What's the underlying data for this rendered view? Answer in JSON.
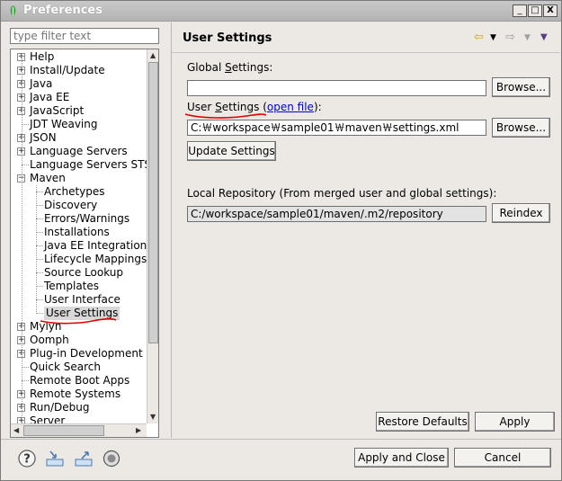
{
  "window": {
    "title": "Preferences",
    "controls": {
      "minimize": "_",
      "maximize": "□",
      "close": "X"
    }
  },
  "filter": {
    "placeholder": "type filter text"
  },
  "tree": {
    "items": [
      {
        "label": "Help",
        "expander": "+"
      },
      {
        "label": "Install/Update",
        "expander": "+"
      },
      {
        "label": "Java",
        "expander": "+"
      },
      {
        "label": "Java EE",
        "expander": "+"
      },
      {
        "label": "JavaScript",
        "expander": "+"
      },
      {
        "label": "JDT Weaving",
        "expander": ""
      },
      {
        "label": "JSON",
        "expander": "+"
      },
      {
        "label": "Language Servers",
        "expander": "+"
      },
      {
        "label": "Language Servers STS",
        "expander": ""
      },
      {
        "label": "Maven",
        "expander": "−"
      },
      {
        "label": "Archetypes",
        "expander": ""
      },
      {
        "label": "Discovery",
        "expander": ""
      },
      {
        "label": "Errors/Warnings",
        "expander": ""
      },
      {
        "label": "Installations",
        "expander": ""
      },
      {
        "label": "Java EE Integration",
        "expander": ""
      },
      {
        "label": "Lifecycle Mappings",
        "expander": ""
      },
      {
        "label": "Source Lookup",
        "expander": ""
      },
      {
        "label": "Templates",
        "expander": ""
      },
      {
        "label": "User Interface",
        "expander": ""
      },
      {
        "label": "User Settings",
        "expander": ""
      },
      {
        "label": "Mylyn",
        "expander": "+"
      },
      {
        "label": "Oomph",
        "expander": "+"
      },
      {
        "label": "Plug-in Development",
        "expander": "+"
      },
      {
        "label": "Quick Search",
        "expander": ""
      },
      {
        "label": "Remote Boot Apps",
        "expander": ""
      },
      {
        "label": "Remote Systems",
        "expander": "+"
      },
      {
        "label": "Run/Debug",
        "expander": "+"
      },
      {
        "label": "Server",
        "expander": "+"
      }
    ]
  },
  "page": {
    "title": "User Settings",
    "global_settings": {
      "label_pre": "Global ",
      "label_ul": "S",
      "label_post": "ettings:",
      "value": "",
      "browse": "Browse..."
    },
    "user_settings": {
      "label_pre": "User ",
      "label_ul": "S",
      "label_post": "ettings (",
      "link": "open file",
      "label_end": "):",
      "value": "C:￦workspace￦sample01￦maven￦settings.xml",
      "browse": "Browse..."
    },
    "update_button": "Update Settings",
    "local_repo": {
      "label": "Local Repository (From merged user and global settings):",
      "value": "C:/workspace/sample01/maven/.m2/repository",
      "reindex": "Reindex"
    },
    "restore_defaults": "Restore Defaults",
    "apply": "Apply"
  },
  "footer": {
    "apply_and_close": "Apply and Close",
    "cancel": "Cancel"
  },
  "colors": {
    "annotation_red": "#e00000",
    "link_blue": "#0000cc"
  }
}
